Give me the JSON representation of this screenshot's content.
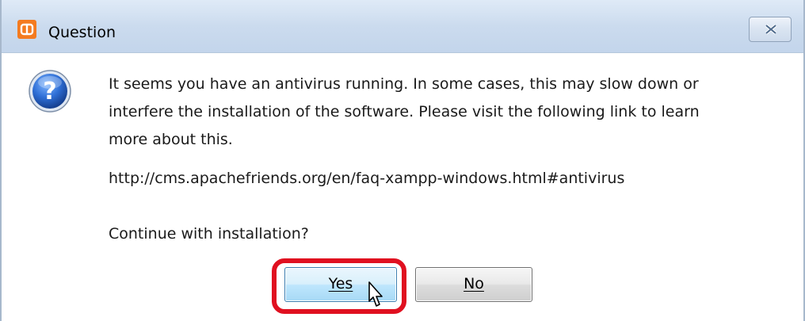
{
  "window": {
    "title": "Question",
    "close_icon": "close-icon",
    "app_icon": "xampp-icon"
  },
  "dialog": {
    "icon": "question-icon",
    "message": "It seems you have an antivirus running. In some cases, this may slow down or\ninterfere the installation of the software. Please visit the following link to learn\nmore about this.",
    "link": "http://cms.apachefriends.org/en/faq-xampp-windows.html#antivirus",
    "prompt": "Continue with installation?"
  },
  "buttons": {
    "yes_label": "Yes",
    "no_label": "No"
  },
  "colors": {
    "highlight": "#e01020",
    "titlebar": "#cbdbee",
    "app_icon": "#f47b20"
  }
}
